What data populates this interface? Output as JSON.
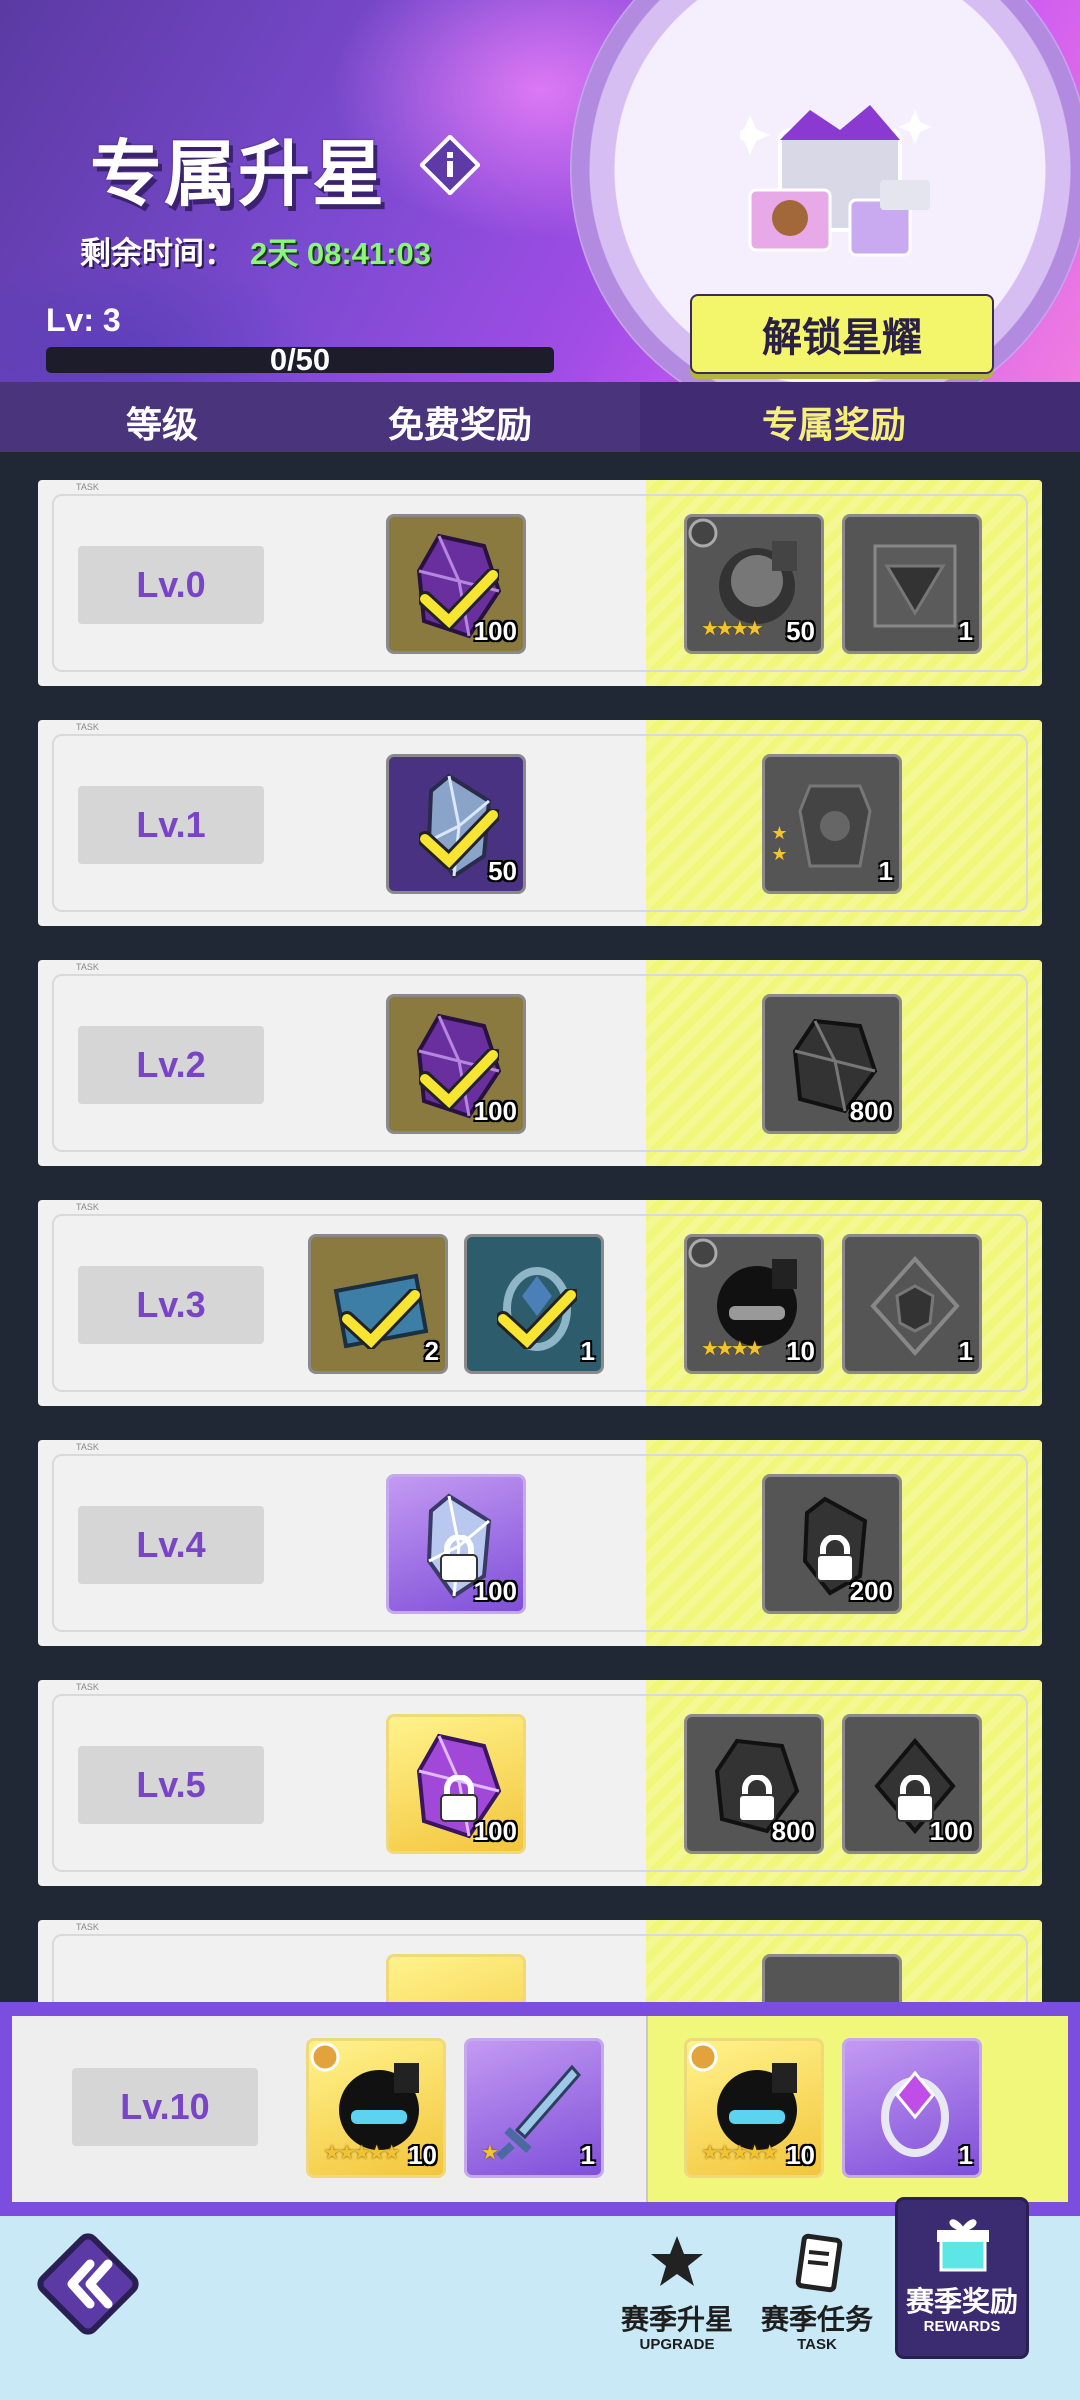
{
  "header": {
    "title": "专属升星",
    "timer_label": "剩余时间：",
    "timer_value": "2天 08:41:03",
    "level": "Lv: 3",
    "progress_text": "0/50",
    "progress_fraction": 0,
    "unlock_button": "解锁星耀"
  },
  "columns": {
    "level": "等级",
    "free": "免费奖励",
    "exclusive": "专属奖励"
  },
  "task_tag": "TASK",
  "rows": [
    {
      "level": "Lv.0",
      "free": [
        {
          "count": "100",
          "state": "claimed"
        }
      ],
      "exclusive": [
        {
          "count": "50",
          "stars": "★★★★"
        },
        {
          "count": "1"
        }
      ]
    },
    {
      "level": "Lv.1",
      "free": [
        {
          "count": "50",
          "state": "claimed"
        }
      ],
      "exclusive": [
        {
          "count": "1",
          "stars": "★★"
        }
      ]
    },
    {
      "level": "Lv.2",
      "free": [
        {
          "count": "100",
          "state": "claimed"
        }
      ],
      "exclusive": [
        {
          "count": "800"
        }
      ]
    },
    {
      "level": "Lv.3",
      "free": [
        {
          "count": "2",
          "state": "claimed"
        },
        {
          "count": "1",
          "state": "claimed"
        }
      ],
      "exclusive": [
        {
          "count": "10",
          "stars": "★★★★"
        },
        {
          "count": "1"
        }
      ]
    },
    {
      "level": "Lv.4",
      "free": [
        {
          "count": "100",
          "state": "locked"
        }
      ],
      "exclusive": [
        {
          "count": "200",
          "state": "locked"
        }
      ]
    },
    {
      "level": "Lv.5",
      "free": [
        {
          "count": "100",
          "state": "locked"
        }
      ],
      "exclusive": [
        {
          "count": "800",
          "state": "locked"
        },
        {
          "count": "100",
          "state": "locked"
        }
      ]
    }
  ],
  "pinned_row": {
    "level": "Lv.10",
    "free": [
      {
        "count": "10",
        "stars": "★★★★★"
      },
      {
        "count": "1",
        "stars": "★"
      }
    ],
    "exclusive": [
      {
        "count": "10",
        "stars": "★★★★★"
      },
      {
        "count": "1"
      }
    ]
  },
  "nav": {
    "upgrade_label": "赛季升星",
    "upgrade_sub": "UPGRADE",
    "task_label": "赛季任务",
    "task_sub": "TASK",
    "rewards_label": "赛季奖励",
    "rewards_sub": "REWARDS"
  },
  "colors": {
    "accent_purple": "#7a44c7",
    "exclusive_yellow": "#f1f77b",
    "timer_green": "#8cf57a"
  }
}
